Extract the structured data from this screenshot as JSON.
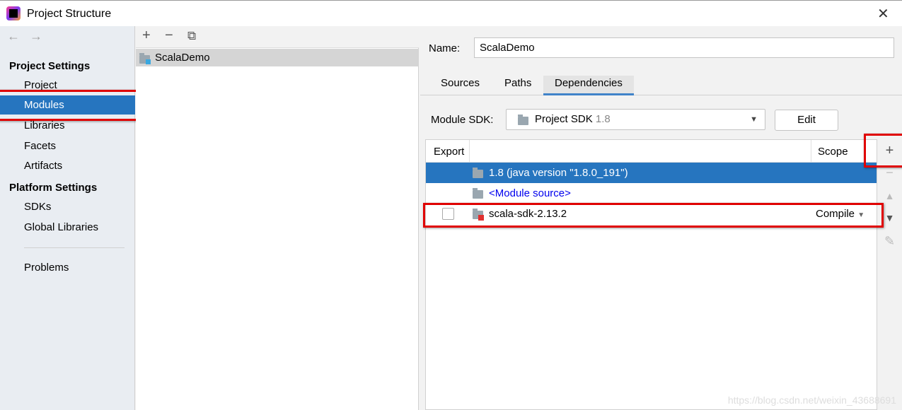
{
  "window": {
    "title": "Project Structure",
    "close_icon": "close-icon"
  },
  "sidebar": {
    "back": "←",
    "forward": "→",
    "sections": [
      {
        "header": "Project Settings",
        "items": [
          "Project",
          "Modules",
          "Libraries",
          "Facets",
          "Artifacts"
        ]
      },
      {
        "header": "Platform Settings",
        "items": [
          "SDKs",
          "Global Libraries"
        ]
      }
    ],
    "problems": "Problems",
    "selected": "Modules"
  },
  "modules": {
    "toolbar": {
      "add": "+",
      "remove": "−",
      "copy": "⧉"
    },
    "items": [
      "ScalaDemo"
    ]
  },
  "details": {
    "name_label": "Name:",
    "name_value": "ScalaDemo",
    "tabs": [
      "Sources",
      "Paths",
      "Dependencies"
    ],
    "active_tab": "Dependencies",
    "sdk_label": "Module SDK:",
    "sdk_value": "Project SDK",
    "sdk_version": "1.8",
    "edit_label": "Edit",
    "table": {
      "headers": [
        "Export",
        "",
        "Scope"
      ],
      "rows": [
        {
          "name": "1.8 (java version \"1.8.0_191\")",
          "scope": "",
          "selected": true
        },
        {
          "name": "<Module source>",
          "scope": "",
          "link": true
        },
        {
          "name": "scala-sdk-2.13.2",
          "scope": "Compile",
          "export": false
        }
      ]
    },
    "side_toolbar": {
      "add": "+",
      "remove": "−",
      "up": "▲",
      "down": "▼",
      "edit": "✎"
    }
  },
  "colors": {
    "selection": "#2675bf",
    "highlight": "#e00000",
    "link": "#0000ee"
  },
  "watermark": "https://blog.csdn.net/weixin_43688691"
}
